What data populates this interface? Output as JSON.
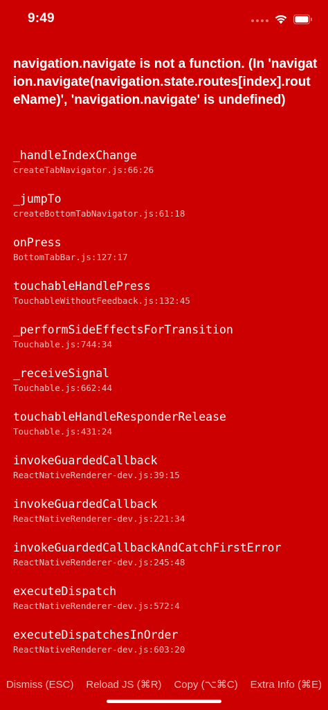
{
  "status_bar": {
    "time": "9:49"
  },
  "error": {
    "message": "navigation.navigate is not a function. (In 'navigation.navigate(navigation.state.routes[index].routeName)', 'navigation.navigate' is undefined)"
  },
  "stack": [
    {
      "method": "_handleIndexChange",
      "file": "createTabNavigator.js:66:26"
    },
    {
      "method": "_jumpTo",
      "file": "createBottomTabNavigator.js:61:18"
    },
    {
      "method": "onPress",
      "file": "BottomTabBar.js:127:17"
    },
    {
      "method": "touchableHandlePress",
      "file": "TouchableWithoutFeedback.js:132:45"
    },
    {
      "method": "_performSideEffectsForTransition",
      "file": "Touchable.js:744:34"
    },
    {
      "method": "_receiveSignal",
      "file": "Touchable.js:662:44"
    },
    {
      "method": "touchableHandleResponderRelease",
      "file": "Touchable.js:431:24"
    },
    {
      "method": "invokeGuardedCallback",
      "file": "ReactNativeRenderer-dev.js:39:15"
    },
    {
      "method": "invokeGuardedCallback",
      "file": "ReactNativeRenderer-dev.js:221:34"
    },
    {
      "method": "invokeGuardedCallbackAndCatchFirstError",
      "file": "ReactNativeRenderer-dev.js:245:48"
    },
    {
      "method": "executeDispatch",
      "file": "ReactNativeRenderer-dev.js:572:4"
    },
    {
      "method": "executeDispatchesInOrder",
      "file": "ReactNativeRenderer-dev.js:603:20"
    }
  ],
  "footer": {
    "dismiss_label": "Dismiss (ESC)",
    "reload_label": "Reload JS (⌘R)",
    "copy_label": "Copy (⌥⌘C)",
    "extra_label": "Extra Info (⌘E)"
  },
  "colors": {
    "background": "#cc0000",
    "text": "#ffffff"
  }
}
